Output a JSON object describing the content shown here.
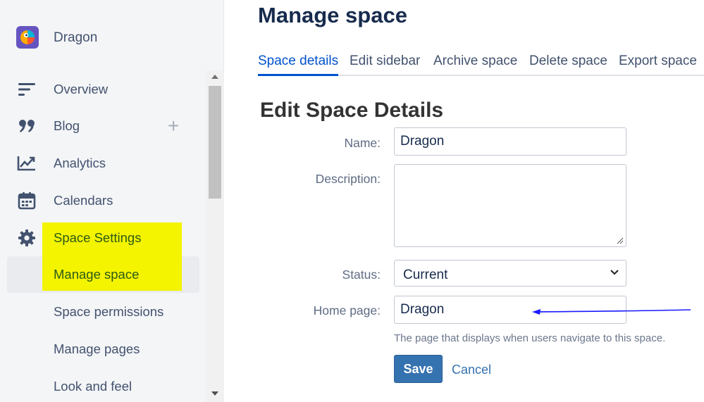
{
  "sidebar": {
    "space_name": "Dragon",
    "items": [
      {
        "label": "Overview",
        "icon": "overview-lines-icon"
      },
      {
        "label": "Blog",
        "icon": "quote-icon",
        "action": "+"
      },
      {
        "label": "Analytics",
        "icon": "analytics-chart-icon"
      },
      {
        "label": "Calendars",
        "icon": "calendar-icon"
      },
      {
        "label": "Space Settings",
        "icon": "gear-icon"
      },
      {
        "label": "Manage space"
      },
      {
        "label": "Space permissions"
      },
      {
        "label": "Manage pages"
      },
      {
        "label": "Look and feel"
      }
    ],
    "colors": {
      "highlight": "#f4f400",
      "selected_bg": "#e9ebee"
    }
  },
  "main": {
    "page_title": "Manage space",
    "tabs": [
      {
        "label": "Space details",
        "active": true
      },
      {
        "label": "Edit sidebar"
      },
      {
        "label": "Archive space"
      },
      {
        "label": "Delete space"
      },
      {
        "label": "Export space"
      }
    ],
    "section_title": "Edit Space Details",
    "form": {
      "name_label": "Name:",
      "name_value": "Dragon",
      "description_label": "Description:",
      "description_value": "",
      "status_label": "Status:",
      "status_value": "Current",
      "home_label": "Home page:",
      "home_value": "Dragon",
      "home_hint": "The page that displays when users navigate to this space.",
      "save_label": "Save",
      "cancel_label": "Cancel"
    },
    "colors": {
      "accent": "#0052cc",
      "button": "#3572b0",
      "arrow": "#1a1aff"
    }
  }
}
